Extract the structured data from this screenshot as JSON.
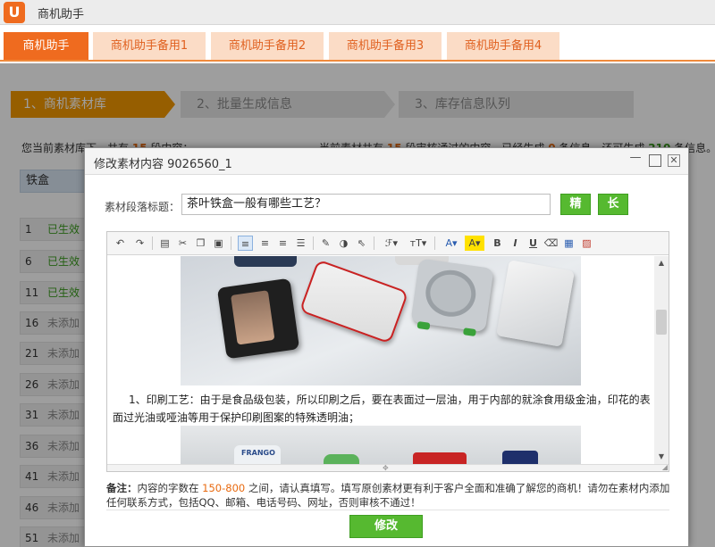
{
  "app": {
    "title": "商机助手",
    "logo": "U"
  },
  "tabs": [
    "商机助手",
    "商机助手备用1",
    "商机助手备用2",
    "商机助手备用3",
    "商机助手备用4"
  ],
  "steps": [
    "1、商机素材库",
    "2、批量生成信息",
    "3、库存信息队列"
  ],
  "summary": {
    "left_text": "您当前素材库下，共有",
    "left_count": "15",
    "left_suffix": "段内容；",
    "right_text": "当前素材共有",
    "right_count": "15",
    "right_mid1": "段审核通过的内容，已经生成",
    "right_generated": "0",
    "right_mid2": "条信息，还可生成",
    "right_remaining": "210",
    "right_suffix": "条信息。"
  },
  "filter_label": "铁盒",
  "rows": [
    {
      "index": "1",
      "status": "已生效",
      "ok": true
    },
    {
      "index": "6",
      "status": "已生效",
      "ok": true
    },
    {
      "index": "11",
      "status": "已生效",
      "ok": true
    },
    {
      "index": "16",
      "status": "未添加",
      "ok": false
    },
    {
      "index": "21",
      "status": "未添加",
      "ok": false
    },
    {
      "index": "26",
      "status": "未添加",
      "ok": false
    },
    {
      "index": "31",
      "status": "未添加",
      "ok": false
    },
    {
      "index": "36",
      "status": "未添加",
      "ok": false
    },
    {
      "index": "41",
      "status": "未添加",
      "ok": false
    },
    {
      "index": "46",
      "status": "未添加",
      "ok": false
    },
    {
      "index": "51",
      "status": "未添加",
      "ok": false
    }
  ],
  "modal": {
    "title": "修改素材内容 9026560_1",
    "para_title_label": "素材段落标题：",
    "para_title_value": "茶叶铁盒一般有哪些工艺？",
    "btn_short": "精",
    "btn_long": "长",
    "content_text": "1、印刷工艺：由于是食品级包装，所以印刷之后，要在表面过一层油，用于内部的就涂食用级金油，印花的表面过光油或哑油等用于保护印刷图案的特殊透明油；",
    "photo2_brand": "FRANGO",
    "note_label": "备注：",
    "note_text_1": "内容的字数在",
    "note_range": "150-800",
    "note_text_2": "之间，请认真填写。填写原创素材更有利于客户全面和准确了解您的商机！请勿在素材内添加任何联系方式，包括QQ、邮箱、电话号码、网址，否则审核不通过！",
    "submit_label": "修改"
  },
  "colors": {
    "accent": "#ef6b1f",
    "step_active": "#f39800",
    "green": "#56b930"
  }
}
